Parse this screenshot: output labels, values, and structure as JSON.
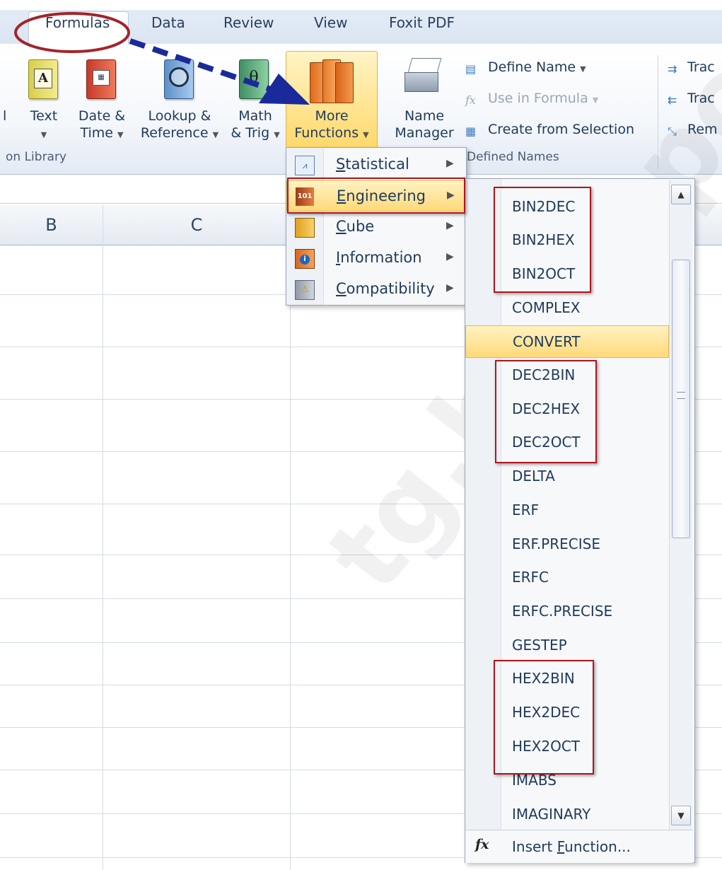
{
  "tabs": [
    "Formulas",
    "Data",
    "Review",
    "View",
    "Foxit PDF"
  ],
  "ribbon": {
    "partial_button_label": "l",
    "text_button": "Text",
    "datetime_button": [
      "Date &",
      "Time"
    ],
    "lookup_button": [
      "Lookup &",
      "Reference"
    ],
    "math_button": [
      "Math",
      "& Trig"
    ],
    "more_functions_button": [
      "More",
      "Functions"
    ],
    "name_manager_button": [
      "Name",
      "Manager"
    ],
    "define_name": "Define Name",
    "use_in_formula": "Use in Formula",
    "create_from_selection": "Create from Selection",
    "trace_precedents_partial": "Trac",
    "trace_dependents_partial": "Trac",
    "remove_arrows_partial": "Rem",
    "group_function_library": "on Library",
    "group_defined_names": "Defined Names"
  },
  "sheet": {
    "column_b": "B",
    "column_c": "C"
  },
  "more_functions_menu": {
    "items": [
      {
        "label": "Statistical",
        "underline": "S",
        "rest": "tatistical",
        "icon": "statistical-icon"
      },
      {
        "label": "Engineering",
        "underline": "E",
        "rest": "ngineering",
        "icon": "engineering-icon"
      },
      {
        "label": "Cube",
        "underline": "C",
        "rest": "ube",
        "icon": "cube-icon"
      },
      {
        "label": "Information",
        "underline": "I",
        "rest": "nformation",
        "icon": "information-icon"
      },
      {
        "label": "Compatibility",
        "underline": "C",
        "rest": "ompatibility",
        "icon": "compatibility-icon"
      }
    ],
    "highlighted": "Engineering",
    "engineering_icon_text": "101"
  },
  "engineering_menu": {
    "functions": [
      "BIN2DEC",
      "BIN2HEX",
      "BIN2OCT",
      "COMPLEX",
      "CONVERT",
      "DEC2BIN",
      "DEC2HEX",
      "DEC2OCT",
      "DELTA",
      "ERF",
      "ERF.PRECISE",
      "ERFC",
      "ERFC.PRECISE",
      "GESTEP",
      "HEX2BIN",
      "HEX2DEC",
      "HEX2OCT",
      "IMABS",
      "IMAGINARY"
    ],
    "highlighted": "CONVERT",
    "insert_function": {
      "prefix": "Insert ",
      "underline": "F",
      "rest": "unction..."
    },
    "insert_function_icon": "fx"
  },
  "annotations": {
    "circle_color": "#a3242b",
    "arrow_color": "#1a2a9a",
    "box_color": "#b0151e"
  },
  "watermark": "tg.blogspot"
}
